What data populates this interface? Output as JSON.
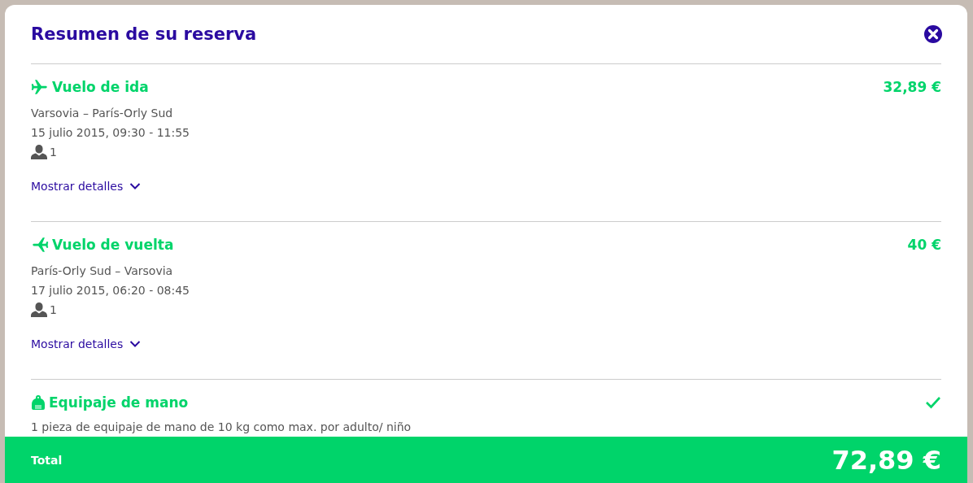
{
  "title": "Resumen de su reserva",
  "sections": [
    {
      "kind": "outbound",
      "title": "Vuelo de ida",
      "price": "32,89 €",
      "route": "Varsovia – París-Orly Sud",
      "datetime": "15 julio 2015, 09:30 - 11:55",
      "passengers": "1",
      "details_link": "Mostrar detalles"
    },
    {
      "kind": "return",
      "title": "Vuelo de vuelta",
      "price": "40 €",
      "route": "París-Orly Sud – Varsovia",
      "datetime": "17 julio 2015, 06:20 - 08:45",
      "passengers": "1",
      "details_link": "Mostrar detalles"
    },
    {
      "kind": "extra",
      "title": "Equipaje de mano",
      "checked": true,
      "description": "1 pieza de equipaje de mano de 10 kg como max. por adulto/ niño"
    }
  ],
  "total": {
    "label": "Total",
    "amount": "72,89 €"
  }
}
